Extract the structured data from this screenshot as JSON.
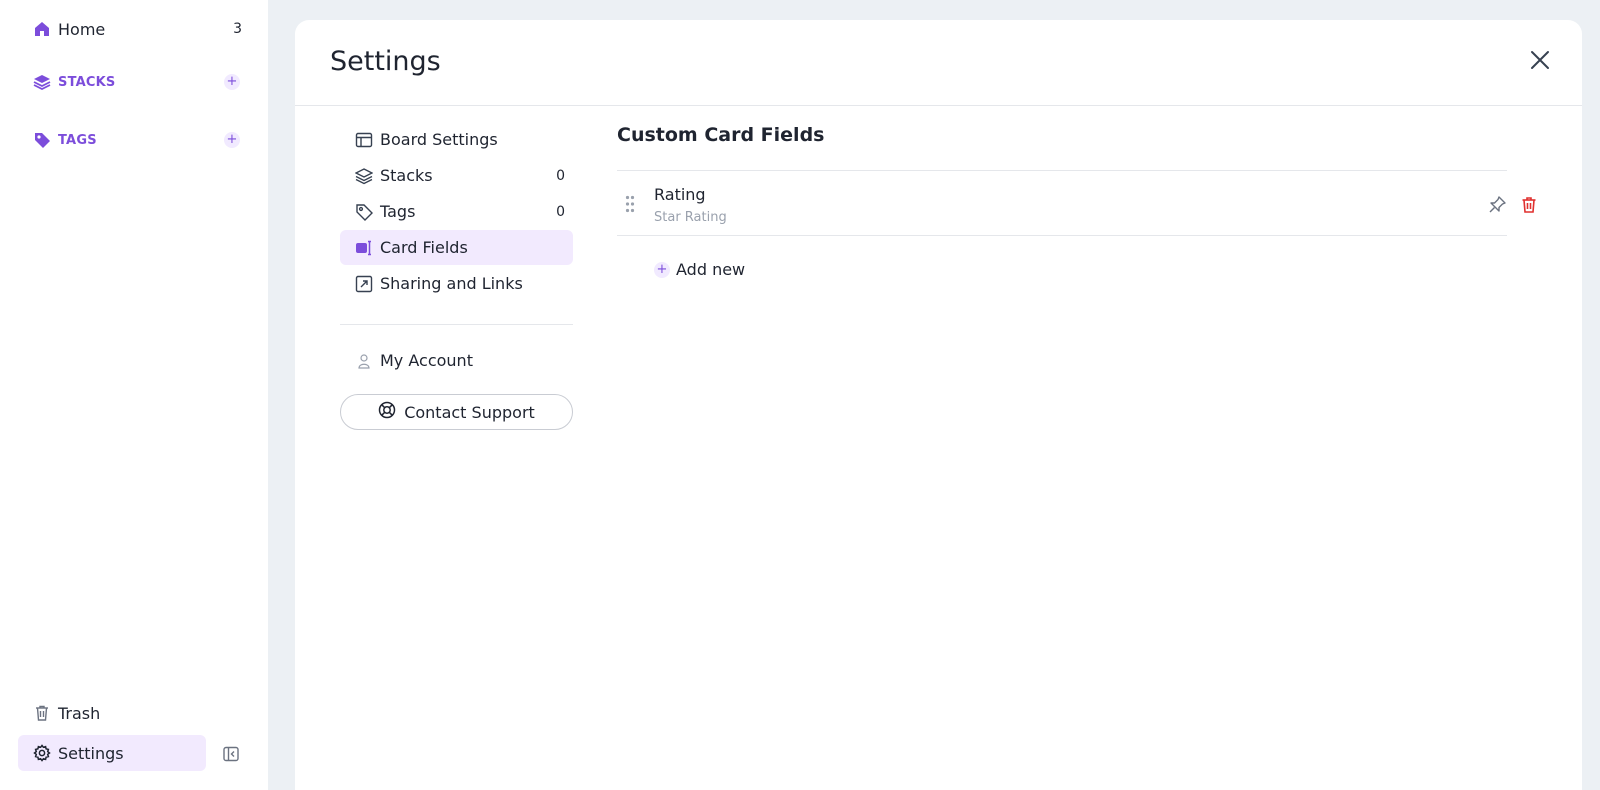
{
  "sidebar": {
    "home": {
      "label": "Home",
      "count": "3"
    },
    "stacks": {
      "label": "STACKS",
      "add": "+"
    },
    "tags": {
      "label": "TAGS",
      "add": "+"
    },
    "trash": {
      "label": "Trash"
    },
    "settings": {
      "label": "Settings"
    }
  },
  "panel": {
    "title": "Settings",
    "nav": {
      "board_settings": {
        "label": "Board Settings"
      },
      "stacks": {
        "label": "Stacks",
        "count": "0"
      },
      "tags": {
        "label": "Tags",
        "count": "0"
      },
      "card_fields": {
        "label": "Card Fields"
      },
      "sharing": {
        "label": "Sharing and Links"
      },
      "account": {
        "label": "My Account"
      },
      "support": {
        "label": "Contact Support"
      }
    },
    "content": {
      "title": "Custom Card Fields",
      "fields": [
        {
          "name": "Rating",
          "type": "Star Rating"
        }
      ],
      "add_new": {
        "label": "Add new",
        "icon": "+"
      }
    }
  },
  "colors": {
    "accent": "#7c4ddb",
    "active_bg": "#f2eafe",
    "danger": "#e0312f",
    "page_bg": "#ecf0f4"
  },
  "icons": [
    "home-icon",
    "stacks-icon",
    "tags-icon",
    "trash-icon",
    "gear-icon",
    "collapse-sidebar-icon",
    "close-icon",
    "board-icon",
    "card-fields-icon",
    "share-icon",
    "account-icon",
    "lifebuoy-icon",
    "drag-handle-icon",
    "pin-icon",
    "delete-icon",
    "plus-icon"
  ]
}
